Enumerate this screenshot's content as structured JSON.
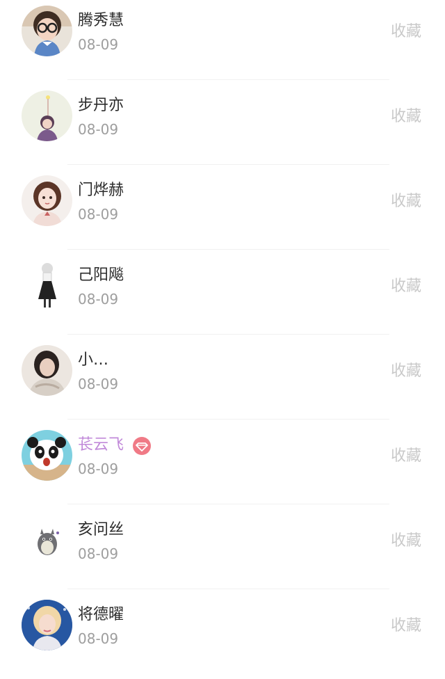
{
  "items": [
    {
      "name": "腾秀慧",
      "date": "08-09",
      "action": "收藏",
      "avatar": "girl-with-glasses-avatar"
    },
    {
      "name": "步丹亦",
      "date": "08-09",
      "action": "收藏",
      "avatar": "girl-with-sparkler-avatar"
    },
    {
      "name": "门烨赫",
      "date": "08-09",
      "action": "收藏",
      "avatar": "illustrated-girl-avatar"
    },
    {
      "name": "己阳飚",
      "date": "08-09",
      "action": "收藏",
      "avatar": "girl-in-dress-avatar"
    },
    {
      "name": "小…",
      "date": "08-09",
      "action": "收藏",
      "avatar": "dark-hair-girl-avatar"
    },
    {
      "name": "苌云飞",
      "date": "08-09",
      "action": "收藏",
      "avatar": "panda-avatar",
      "vip": true,
      "name_color": "#c18ad9",
      "badge_color": "#f07a86",
      "badge_icon": "diamond-icon"
    },
    {
      "name": "亥问丝",
      "date": "08-09",
      "action": "收藏",
      "avatar": "totoro-avatar"
    },
    {
      "name": "将德曜",
      "date": "08-09",
      "action": "收藏",
      "avatar": "blonde-girl-avatar"
    }
  ],
  "colors": {
    "name": "#2b2b2b",
    "date": "#9e9e9e",
    "action": "#c9c9c9",
    "divider": "#f1f1f1"
  }
}
